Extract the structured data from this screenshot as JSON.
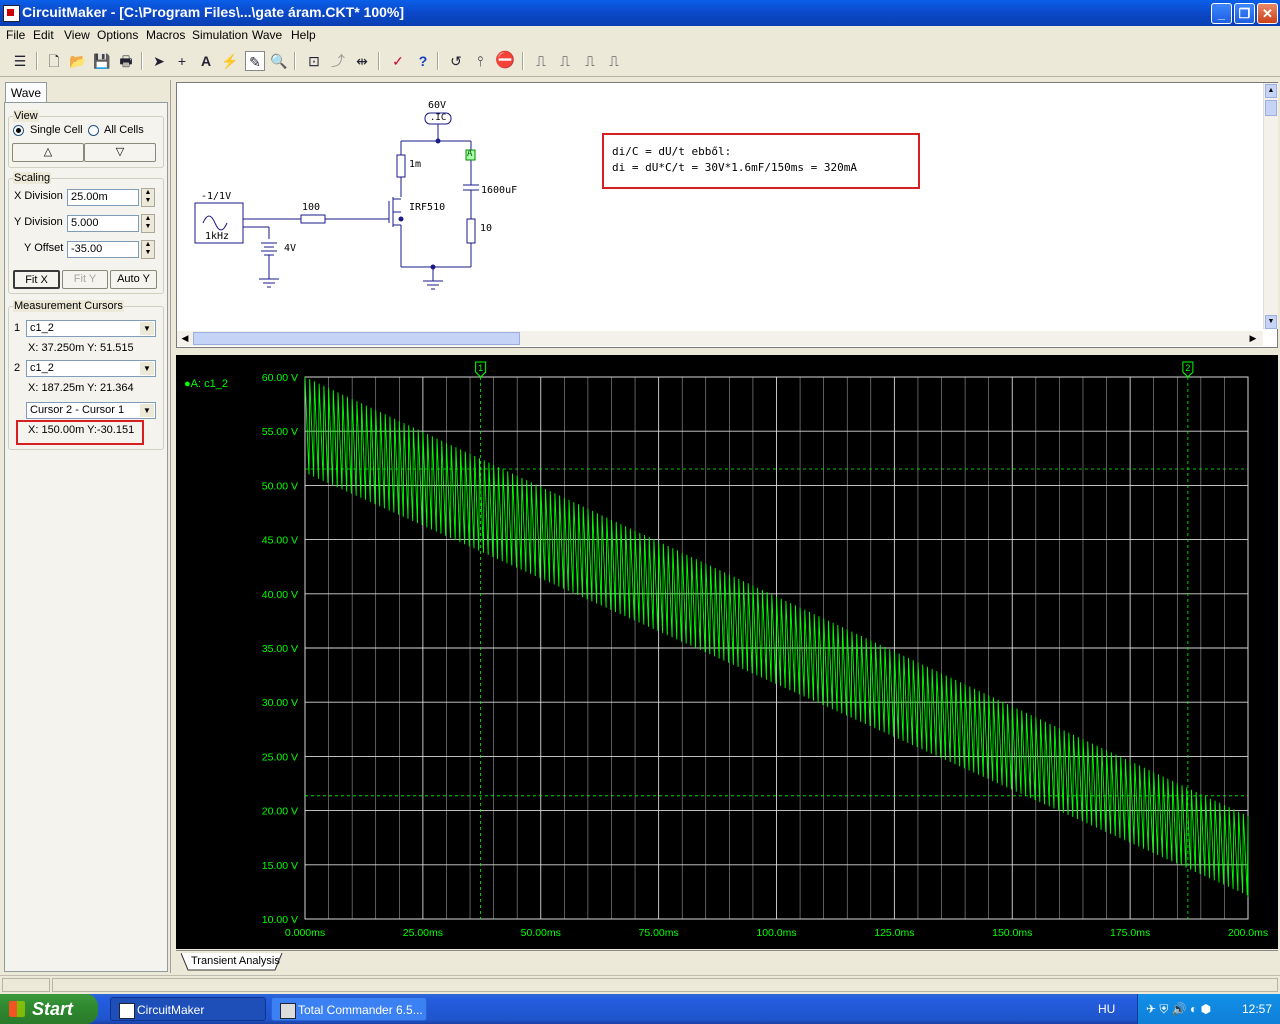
{
  "window": {
    "title": "CircuitMaker - [C:\\Program Files\\...\\gate áram.CKT* 100%]"
  },
  "menu": [
    "File",
    "Edit",
    "View",
    "Options",
    "Macros",
    "Simulation",
    "Wave",
    "Help"
  ],
  "left": {
    "tab": "Wave",
    "view": {
      "label": "View",
      "single": "Single Cell",
      "all": "All Cells",
      "up": "△",
      "down": "▽"
    },
    "scaling": {
      "label": "Scaling",
      "x_label": "X Division",
      "x_value": "25.00m",
      "y_label": "Y Division",
      "y_value": "5.000",
      "off_label": "Y Offset",
      "off_value": "-35.00",
      "fitx": "Fit X",
      "fity": "Fit Y",
      "autoy": "Auto Y"
    },
    "cursors": {
      "label": "Measurement Cursors",
      "c1_num": "1",
      "c1_sel": "c1_2",
      "c1_read": "X: 37.250m  Y: 51.515",
      "c2_num": "2",
      "c2_sel": "c1_2",
      "c2_read": "X: 187.25m  Y: 21.364",
      "diff_sel": "Cursor 2 - Cursor 1",
      "diff_read": "X: 150.00m  Y:-30.151"
    }
  },
  "schematic": {
    "v60": "60V",
    "ic": ".IC",
    "r1m": "1m",
    "a_probe": "A",
    "cap": "1600uF",
    "mosfet": "IRF510",
    "r100": "100",
    "r10": "10",
    "src_amp": "-1/1V",
    "src_freq": "1kHz",
    "bat": "4V",
    "note1": "di/C = dU/t ebből:",
    "note2": "di = dU*C/t = 30V*1.6mF/150ms = 320mA"
  },
  "chart_data": {
    "type": "line",
    "title": "",
    "legend": "A: c1_2",
    "series": [
      {
        "name": "A: c1_2",
        "color": "#00ff00",
        "env_start": [
          51.0,
          60.0
        ],
        "env_end": [
          12.0,
          19.5
        ],
        "ripple_cycles": 200
      }
    ],
    "xlim": [
      0,
      200
    ],
    "ylim": [
      10,
      60
    ],
    "x_ticks": [
      "0.000ms",
      "25.00ms",
      "50.00ms",
      "75.00ms",
      "100.0ms",
      "125.0ms",
      "150.0ms",
      "175.0ms",
      "200.0ms"
    ],
    "y_ticks": [
      "60.00 V",
      "55.00 V",
      "50.00 V",
      "45.00 V",
      "40.00 V",
      "35.00 V",
      "30.00 V",
      "25.00 V",
      "20.00 V",
      "15.00 V",
      "10.00 V"
    ],
    "cursors": [
      {
        "label": "1",
        "x": 37.25,
        "y": 51.515
      },
      {
        "label": "2",
        "x": 187.25,
        "y": 21.364
      }
    ],
    "grid": true
  },
  "bottom": {
    "tab": "Transient Analysis"
  },
  "taskbar": {
    "start": "Start",
    "t1": "CircuitMaker",
    "t2": "Total Commander 6.5...",
    "lang": "HU",
    "clock": "12:57"
  }
}
